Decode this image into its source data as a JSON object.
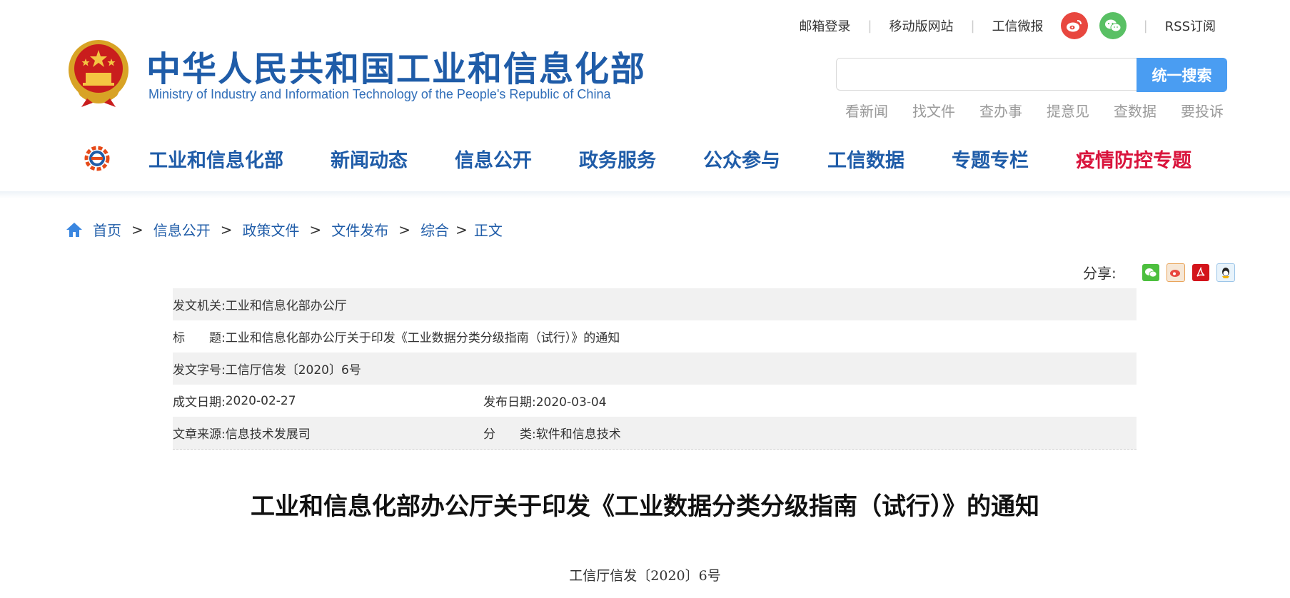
{
  "header": {
    "logo_cn": "中华人民共和国工业和信息化部",
    "logo_en": "Ministry of Industry and Information Technology of the People's Republic of China",
    "toplinks": [
      "邮箱登录",
      "移动版网站",
      "工信微报",
      "RSS订阅"
    ],
    "search": {
      "placeholder": "",
      "button": "统一搜索"
    },
    "quicklinks": [
      "看新闻",
      "找文件",
      "查办事",
      "提意见",
      "查数据",
      "要投诉"
    ]
  },
  "nav": {
    "items": [
      "工业和信息化部",
      "新闻动态",
      "信息公开",
      "政务服务",
      "公众参与",
      "工信数据",
      "专题专栏",
      "疫情防控专题"
    ],
    "highlight_color": "#d9143c",
    "brand_color": "#1f5ca8"
  },
  "breadcrumb": [
    "首页",
    "信息公开",
    "政策文件",
    "文件发布",
    "综合",
    "正文"
  ],
  "share": {
    "label": "分享:",
    "icons": [
      "wechat-icon",
      "weibo-icon",
      "pdf-icon",
      "qq-icon"
    ]
  },
  "meta": {
    "issuer_label": "发文机关:",
    "issuer": "工业和信息化部办公厅",
    "title_label": "标　　题:",
    "title": "工业和信息化部办公厅关于印发《工业数据分类分级指南（试行）》的通知",
    "docno_label": "发文字号:",
    "docno": "工信厅信发〔2020〕6号",
    "created_label": "成文日期:",
    "created": "2020-02-27",
    "published_label": "发布日期:",
    "published": "2020-03-04",
    "source_label": "文章来源:",
    "source": "信息技术发展司",
    "category_label": "分　　类:",
    "category": "软件和信息技术"
  },
  "document": {
    "title": "工业和信息化部办公厅关于印发《工业数据分类分级指南（试行）》的通知",
    "number": "工信厅信发〔2020〕6号"
  }
}
